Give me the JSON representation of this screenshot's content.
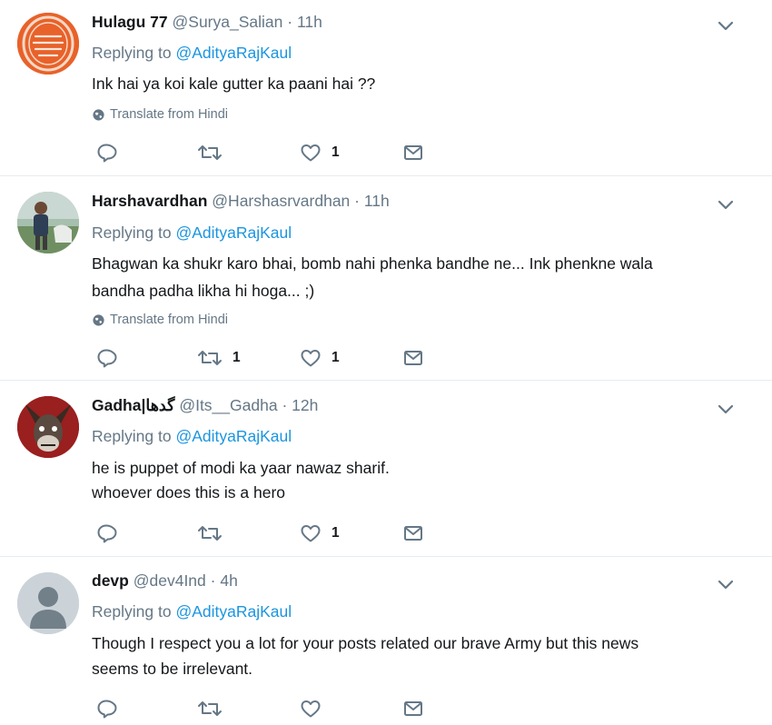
{
  "tweets": [
    {
      "name": "Hulagu 77",
      "handle": "@Surya_Salian",
      "sep": "·",
      "time": "11h",
      "replying_prefix": "Replying to",
      "replying_to": "@AdityaRajKaul",
      "lines": [
        "Ink hai ya koi kale gutter ka paani hai ??"
      ],
      "translate": "Translate from Hindi",
      "counts": {
        "reply": "",
        "retweet": "",
        "like": "1"
      },
      "avatar_color": "#e2571e"
    },
    {
      "name": "Harshavardhan",
      "handle": "@Harshasrvardhan",
      "sep": "·",
      "time": "11h",
      "replying_prefix": "Replying to",
      "replying_to": "@AdityaRajKaul",
      "lines": [
        "Bhagwan ka shukr karo bhai, bomb nahi phenka bandhe ne... Ink phenkne wala",
        "bandha padha likha hi hoga... ;)"
      ],
      "translate": "Translate from Hindi",
      "counts": {
        "reply": "",
        "retweet": "1",
        "like": "1"
      },
      "avatar_color": "#7fa37a"
    },
    {
      "name": "Gadha|گدھا",
      "handle": "@Its__Gadha",
      "sep": "·",
      "time": "12h",
      "replying_prefix": "Replying to",
      "replying_to": "@AdityaRajKaul",
      "lines": [
        "he is puppet of modi ka yaar nawaz sharif.",
        "whoever does this is a hero"
      ],
      "translate": "",
      "counts": {
        "reply": "",
        "retweet": "",
        "like": "1"
      },
      "avatar_color": "#8b1a1a"
    },
    {
      "name": "devp",
      "handle": "@dev4Ind",
      "sep": "·",
      "time": "4h",
      "replying_prefix": "Replying to",
      "replying_to": "@AdityaRajKaul",
      "lines": [
        "Though I respect you a lot for your posts related our brave Army but this news",
        "seems to be irrelevant."
      ],
      "translate": "",
      "counts": {
        "reply": "",
        "retweet": "",
        "like": ""
      },
      "avatar_color": "#c5cdd3"
    }
  ],
  "colors": {
    "link": "#1b95e0",
    "muted": "#657786",
    "divider": "#e6ecf0"
  },
  "icons": [
    "reply-icon",
    "retweet-icon",
    "like-icon",
    "direct-message-icon",
    "chevron-down-icon",
    "globe-icon"
  ]
}
